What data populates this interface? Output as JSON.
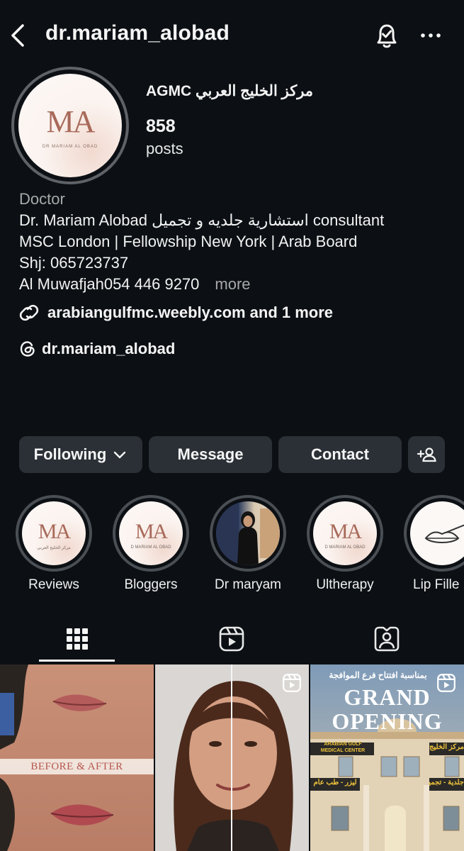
{
  "header": {
    "username": "dr.mariam_alobad",
    "back_icon": "chevron-left-icon",
    "notify_icon": "bell-check-icon",
    "more_icon": "ellipsis-icon"
  },
  "profile": {
    "avatar_monogram": "MA",
    "avatar_subtext": "DR MARIAM AL OBAD",
    "display_name": "مركز الخليج العربي  AGMC",
    "posts_count": "858",
    "posts_label": "posts"
  },
  "bio": {
    "category": "Doctor",
    "lines": [
      "Dr. Mariam Alobad استشارية جلديه و تجميل consultant",
      "MSC London | Fellowship New York | Arab Board",
      "Shj: 065723737",
      "Al Muwafjah054 446 9270"
    ],
    "more": "more",
    "link": "arabiangulfmc.weebly.com and 1 more",
    "threads_handle": "dr.mariam_alobad"
  },
  "actions": {
    "following": "Following",
    "message": "Message",
    "contact": "Contact"
  },
  "highlights": [
    {
      "label": "Reviews",
      "monogram": "MA",
      "sub": "مركز الخليج العربي"
    },
    {
      "label": "Bloggers",
      "monogram": "MA",
      "sub": "D MARIAM AL OBAD"
    },
    {
      "label": "Dr maryam"
    },
    {
      "label": "Ultherapy",
      "monogram": "MA",
      "sub": "D MARIAM AL OBAD"
    },
    {
      "label": "Lip Fille"
    }
  ],
  "tabs": [
    "grid-icon",
    "reels-icon",
    "tagged-icon"
  ],
  "posts": {
    "p1_caption": "BEFORE & AFTER",
    "p3_top": "بمناسبة افتتاح فرع الموافجة",
    "p3_title1": "GRAND",
    "p3_title2": "OPENING",
    "p3_sign": "ARABIAN GULF MEDICAL CENTER",
    "p3_sign_ar": "مركز الخليج العربي",
    "p3_banner1": "ليزر - طب عام",
    "p3_banner2": "جلدية - تجميل"
  },
  "colors": {
    "background": "#0c1014",
    "button": "#2b3036",
    "muted": "#a8a8a8",
    "monogram": "#a86a5a"
  }
}
